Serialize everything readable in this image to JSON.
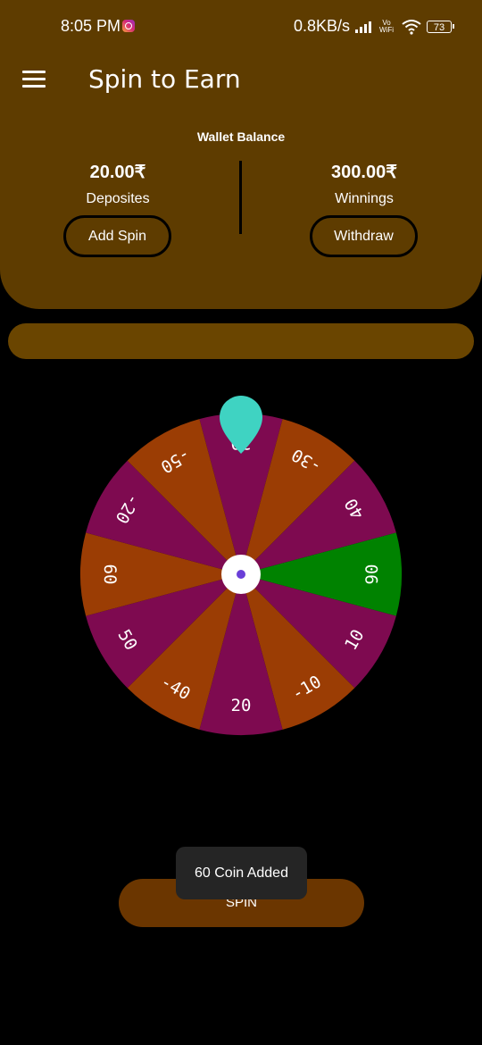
{
  "status_bar": {
    "time": "8:05 PM",
    "speed": "0.8KB/s",
    "vo_label": "Vo",
    "wifi_label": "WiFi",
    "battery": "73"
  },
  "app": {
    "title": "Spin to Earn",
    "menu_icon": "hamburger-menu-icon"
  },
  "wallet": {
    "title": "Wallet Balance",
    "deposits": {
      "amount": "20.00₹",
      "label": "Deposites",
      "button": "Add Spin"
    },
    "winnings": {
      "amount": "300.00₹",
      "label": "Winnings",
      "button": "Withdraw"
    }
  },
  "wheel": {
    "segments": [
      {
        "label": "30",
        "color": "#7e0a50"
      },
      {
        "label": "-30",
        "color": "#9b3d04"
      },
      {
        "label": "40",
        "color": "#7e0a50"
      },
      {
        "label": "90",
        "color": "#008200"
      },
      {
        "label": "10",
        "color": "#7e0a50"
      },
      {
        "label": "-10",
        "color": "#9b3d04"
      },
      {
        "label": "20",
        "color": "#7e0a50"
      },
      {
        "label": "-40",
        "color": "#9b3d04"
      },
      {
        "label": "50",
        "color": "#7e0a50"
      },
      {
        "label": "60",
        "color": "#9b3d04"
      },
      {
        "label": "-20",
        "color": "#7e0a50"
      },
      {
        "label": "-50",
        "color": "#9b3d04"
      }
    ],
    "pointer_color": "#3fd3c2",
    "hub_dot_color": "#6a3fd8"
  },
  "spin_button": {
    "label": "SPIN"
  },
  "toast": {
    "text": "60 Coin Added"
  },
  "colors": {
    "header": "#5e3c00",
    "progress_track": "#6a4500",
    "spin_button": "#6b3600"
  }
}
